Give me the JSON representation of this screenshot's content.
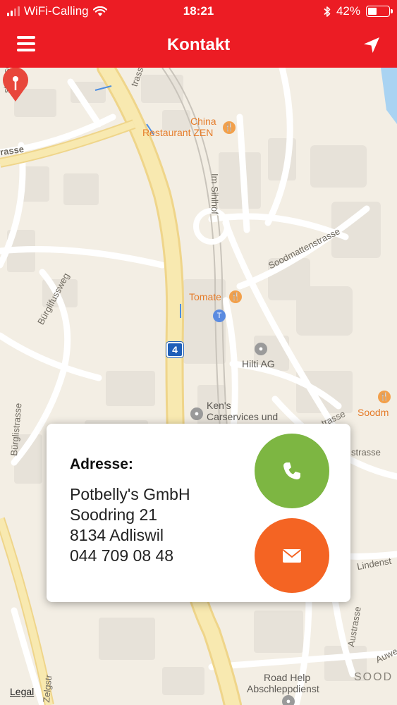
{
  "status_bar": {
    "carrier": "WiFi-Calling",
    "time": "18:21",
    "battery": "42%",
    "battery_level": 0.42
  },
  "nav": {
    "title": "Kontakt",
    "menu_icon": "hamburger-menu-icon",
    "location_icon": "location-arrow-icon"
  },
  "map": {
    "labels": {
      "street_top_left": "strasse",
      "street_top_left2": "trasse",
      "street_left": "rasse",
      "china_line1": "China",
      "china_line2": "Restaurant ZEN",
      "im_sihlhof": "Im Sihlhof",
      "soodmattenstrasse": "Soodmattenstrasse",
      "tomate": "Tomate",
      "burglifussweg": "Bürglifussweg",
      "burglistrasse": "Bürglistrasse",
      "hilti": "Hilti AG",
      "kens_line1": "Ken's",
      "kens_line2": "Carservices und",
      "soodm": "Soodm",
      "trasse_right": "trasse",
      "strasse_right": "strasse",
      "lindenst": "Lindenst",
      "austrasse": "Austrasse",
      "auwe": "Auwe",
      "road_help_line1": "Road Help",
      "road_help_line2": "Abschleppdienst",
      "sood": "SOOD",
      "legal": "Legal",
      "zelgstr": "Zelgstr"
    },
    "route_shield": "4",
    "colors": {
      "land": "#f3eee4",
      "major_road": "#f7e7a8",
      "minor_road": "#ffffff",
      "block": "#e6e1d8",
      "water": "#a9d3f2",
      "pin": "#e8473b"
    }
  },
  "card": {
    "heading": "Adresse:",
    "address": [
      "Potbelly's GmbH",
      "Soodring 21",
      "8134 Adliswil",
      "044 709 08 48"
    ],
    "phone_color": "#7db642",
    "mail_color": "#f46423"
  }
}
